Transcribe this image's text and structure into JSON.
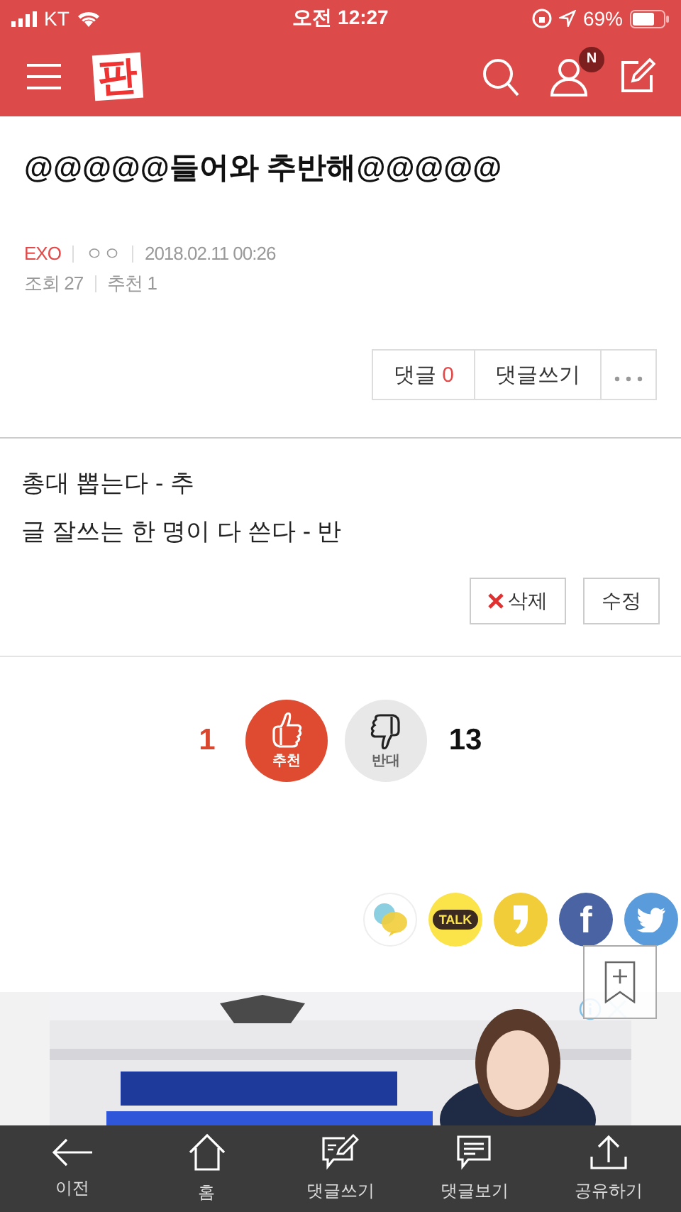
{
  "status_bar": {
    "carrier": "KT",
    "time": "오전 12:27",
    "battery": "69%"
  },
  "header": {
    "logo": "판",
    "notification_badge": "N"
  },
  "post": {
    "title": "@@@@@들어와 추반해@@@@@",
    "category": "EXO",
    "author": "ㅇㅇ",
    "date": "2018.02.11 00:26",
    "views": "조회 27",
    "recommends": "추천 1",
    "actions": [
      {
        "label": "댓글",
        "count": "0"
      },
      {
        "label": "댓글쓰기"
      }
    ],
    "body": [
      "총대 뽑는다 - 추",
      "글 잘쓰는 한 명이 다 쓴다 - 반"
    ],
    "edit_buttons": [
      {
        "kind": "delete",
        "label": "삭제"
      },
      {
        "kind": "edit",
        "label": "수정"
      }
    ]
  },
  "votes": [
    {
      "kind": "up",
      "count": "1",
      "label": "추천"
    },
    {
      "kind": "down",
      "count": "13",
      "label": "반대"
    }
  ],
  "share": [
    {
      "kind": "chat"
    },
    {
      "kind": "talk",
      "label": "TALK"
    },
    {
      "kind": "comma"
    },
    {
      "kind": "facebook",
      "label": "f"
    },
    {
      "kind": "twitter"
    }
  ],
  "bottom_nav": [
    {
      "kind": "back",
      "label": "이전"
    },
    {
      "kind": "home",
      "label": "홈"
    },
    {
      "kind": "write",
      "label": "댓글쓰기"
    },
    {
      "kind": "view",
      "label": "댓글보기"
    },
    {
      "kind": "share",
      "label": "공유하기"
    }
  ]
}
